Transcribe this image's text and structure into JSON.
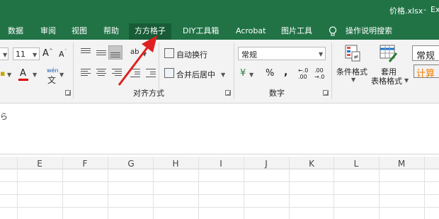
{
  "window": {
    "title": "价格.xlsx",
    "separator": "-",
    "app_fragment": "Ex"
  },
  "tabs": [
    {
      "label": "数据"
    },
    {
      "label": "审阅"
    },
    {
      "label": "视图"
    },
    {
      "label": "帮助"
    },
    {
      "label": "方方格子",
      "active": true
    },
    {
      "label": "DIY工具箱"
    },
    {
      "label": "Acrobat"
    },
    {
      "label": "图片工具"
    }
  ],
  "tell_me": {
    "label": "操作说明搜索",
    "icon": "lightbulb-icon"
  },
  "font": {
    "size_value": "11",
    "increase_label": "A",
    "decrease_label": "A",
    "font_color_label": "A",
    "phonetic_label": "wén"
  },
  "alignment": {
    "orient_label": "ab",
    "wrap_text_label": "自动换行",
    "merge_center_label": "合并后居中",
    "group_label": "对齐方式"
  },
  "number": {
    "format_value": "常规",
    "percent_label": "%",
    "comma_label": ",",
    "increase_decimal_label": "←.0\n.00",
    "decrease_decimal_label": ".00\n→.0",
    "group_label": "数字"
  },
  "styles": {
    "conditional_label": "条件格式",
    "table_label_1": "套用",
    "table_label_2": "表格格式",
    "normal_style": "常规",
    "calc_style": "计算"
  },
  "formula_bar": {
    "content": "ら"
  },
  "columns": [
    "E",
    "F",
    "G",
    "H",
    "I",
    "J",
    "K",
    "L",
    "M"
  ],
  "colors": {
    "accent": "#217346",
    "active_tab": "#185c37",
    "arrow": "#e02020",
    "calc_style_text": "#fa7d00"
  }
}
